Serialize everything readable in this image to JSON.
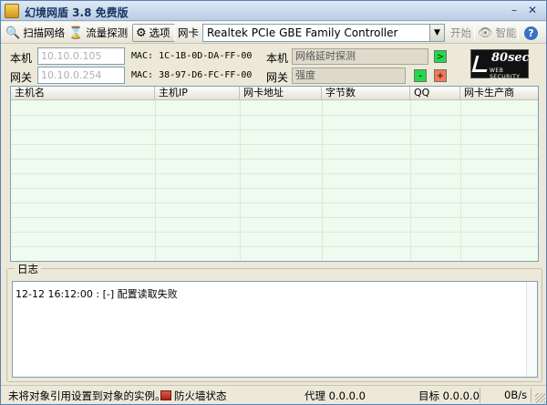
{
  "window": {
    "title": "幻境网盾 3.8 免费版"
  },
  "toolbar": {
    "scan_label": "扫描网络",
    "traffic_label": "流量探测",
    "options_label": "选项",
    "nic_label": "网卡",
    "nic_selected": "Realtek PCIe GBE Family Controller",
    "start_label": "开始",
    "smart_label": "智能",
    "help_symbol": "?"
  },
  "info": {
    "local_label": "本机",
    "local_ip": "10.10.0.105",
    "local_mac": "MAC: 1C-1B-0D-DA-FF-00",
    "gateway_label": "网关",
    "gateway_ip": "10.10.0.254",
    "gateway_mac": "MAC: 38-97-D6-FC-FF-00",
    "local_right_label": "本机",
    "latency_text": "网络延时探测",
    "gateway_right_label": "网关",
    "strength_text": "强度",
    "go_symbol": ">",
    "minus_symbol": "-",
    "plus_symbol": "+"
  },
  "logo": {
    "main": "80sec",
    "sub": "WEB SECURITY"
  },
  "table": {
    "columns": [
      "主机名",
      "主机IP",
      "网卡地址",
      "字节数",
      "QQ",
      "网卡生产商"
    ]
  },
  "log": {
    "title": "日志",
    "lines": [
      "12-12 16:12:00 : [-] 配置读取失败"
    ]
  },
  "status": {
    "message": "未将对象引用设置到对象的实例。",
    "firewall": "防火墙状态",
    "proxy": "代理 0.0.0.0",
    "target": "目标 0.0.0.0",
    "speed": "0B/s"
  },
  "colors": {
    "green_button": "#22d94a",
    "orange_button": "#f07a5a",
    "table_bg": "#eefbee"
  }
}
